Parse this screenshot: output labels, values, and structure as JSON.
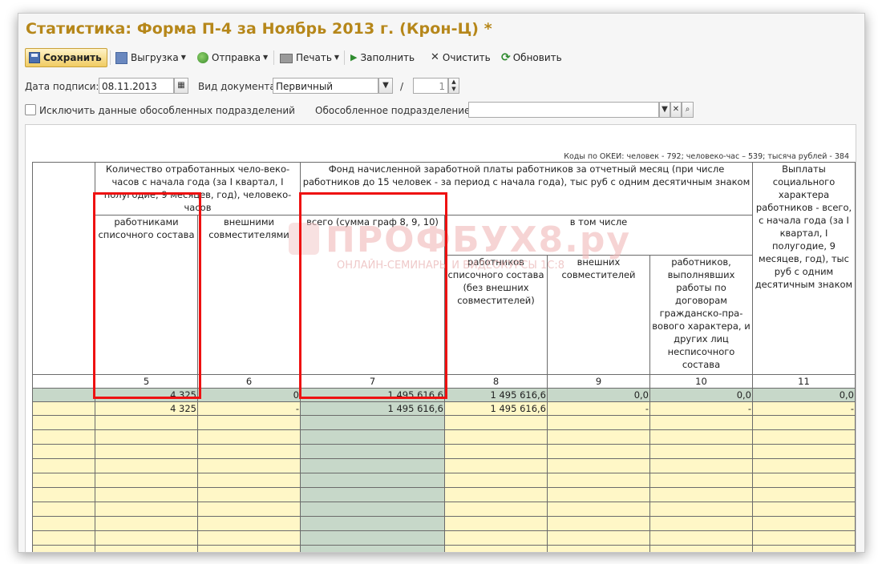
{
  "window": {
    "title": "Статистика: Форма П-4 за Ноябрь 2013 г. (Крон-Ц) *"
  },
  "toolbar": {
    "save": "Сохранить",
    "export": "Выгрузка",
    "send": "Отправка",
    "print": "Печать",
    "fill": "Заполнить",
    "clear": "Очистить",
    "refresh": "Обновить"
  },
  "form": {
    "sign_date_label": "Дата подписи:",
    "sign_date_value": "08.11.2013",
    "doc_type_label": "Вид документа:",
    "doc_type_value": "Первичный",
    "slash": "/",
    "correction_number": "1",
    "exclude_label": "Исключить данные обособленных подразделений",
    "division_label": "Обособленное подразделение:",
    "division_value": ""
  },
  "okei": "Коды по ОКЕИ: человек - 792; человеко-час – 539; тысяча рублей - 384",
  "watermark": {
    "main": "ПРОФБУХ8.ру",
    "sub": "ОНЛАЙН-СЕМИНАРЫ И ВИДЕОКУРСЫ 1С:8"
  },
  "table": {
    "header_hours": "Количество отработанных чело-веко-часов с начала года (за I квартал, I полугодие, 9 месяцев, год), человеко-часов",
    "header_fund": "Фонд начисленной заработной платы работников за отчетный месяц (при числе работников до 15 человек - за период с начала года), тыс руб с одним десятичным знаком",
    "header_social": "Выплаты социального характера работников - всего, с начала года (за I квартал, I полугодие, 9 месяцев, год), тыс руб с одним десятичным знаком",
    "col5": "работниками списочного состава",
    "col6": "внешними совместителями",
    "col7": "всего (сумма граф 8, 9, 10)",
    "incl": "в том числе",
    "col8": "работников списочного состава (без внешних совместителей)",
    "col9": "внешних совместителей",
    "col10": "работников, выполнявших работы по договорам гражданско-пра-вового характера, и других лиц несписочного состава",
    "nums": [
      "5",
      "6",
      "7",
      "8",
      "9",
      "10",
      "11"
    ],
    "row1": [
      "",
      "4 325",
      "0",
      "1 495 616,6",
      "1 495 616,6",
      "0,0",
      "0,0",
      "0,0"
    ],
    "row2": [
      "",
      "4 325",
      "-",
      "1 495 616,6",
      "1 495 616,6",
      "-",
      "-",
      "-"
    ]
  }
}
